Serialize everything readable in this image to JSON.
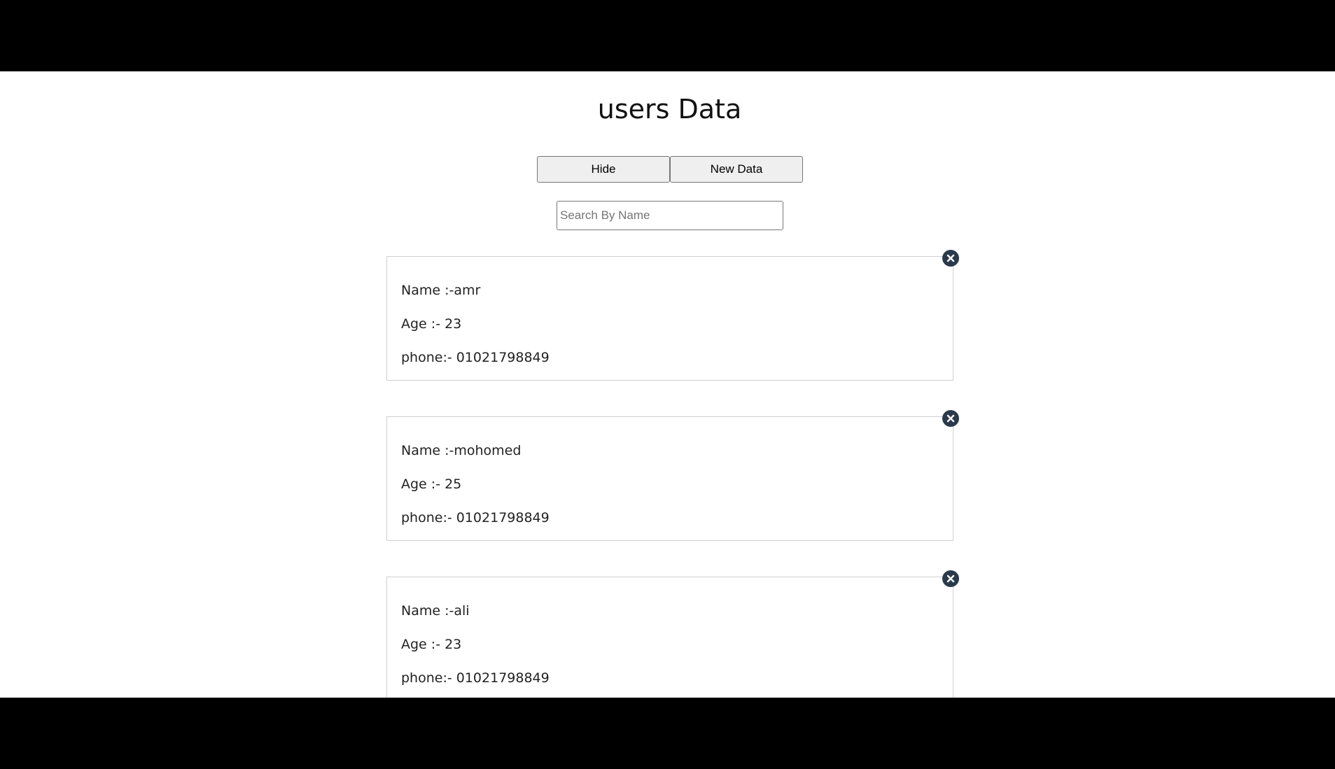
{
  "page": {
    "title": "users Data"
  },
  "toolbar": {
    "hide_label": "Hide",
    "new_data_label": "New Data"
  },
  "search": {
    "placeholder": "Search By Name",
    "value": ""
  },
  "users": [
    {
      "name": "Name :-amr",
      "age": "Age :- 23",
      "phone": "phone:- 01021798849"
    },
    {
      "name": "Name :-mohomed",
      "age": "Age :- 25",
      "phone": "phone:- 01021798849"
    },
    {
      "name": "Name :-ali",
      "age": "Age :- 23",
      "phone": "phone:- 01021798849"
    }
  ],
  "icons": {
    "delete": "close-circle-icon"
  },
  "colors": {
    "delete_icon": "#2b3a4b",
    "card_border": "#cfcfcf",
    "button_bg": "#efefef"
  }
}
